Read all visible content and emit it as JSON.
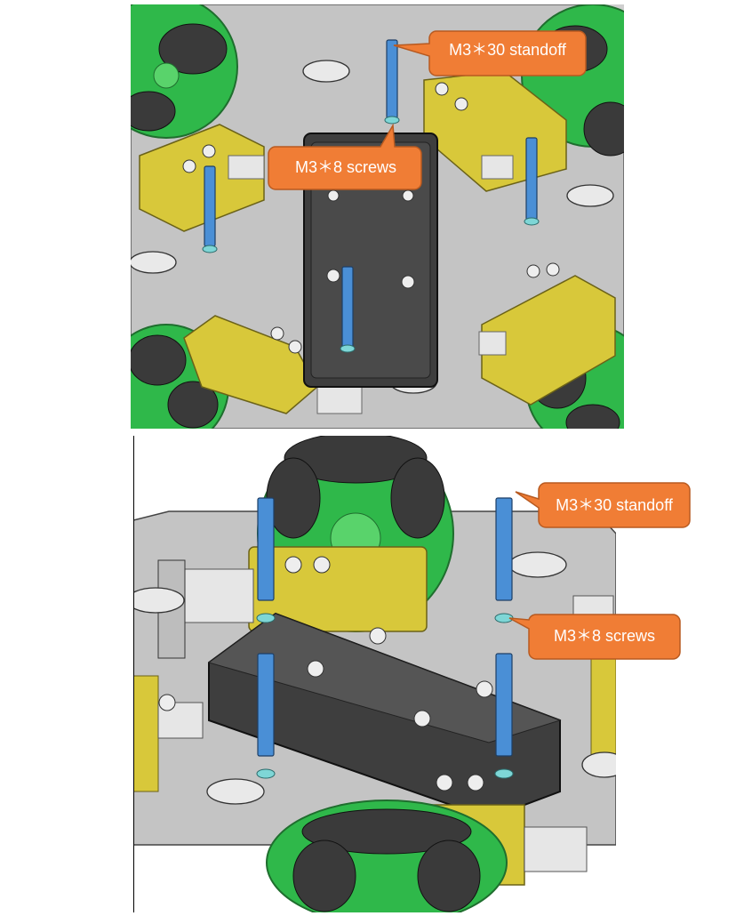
{
  "callouts": {
    "standoff": "M3＊30 standoff",
    "screws": "M3＊8 screws"
  },
  "colors": {
    "callout_fill": "#f07d35",
    "callout_stroke": "#b85a20",
    "standoff_blue": "#4a8fd6",
    "wheel_green": "#2fb84a",
    "roller_dark": "#3a3a3a",
    "motor_yellow": "#d8c83a",
    "plate_gray": "#c8c8c8",
    "battery_dark": "#3e3e3e",
    "screw_cyan": "#7ed6d6"
  }
}
